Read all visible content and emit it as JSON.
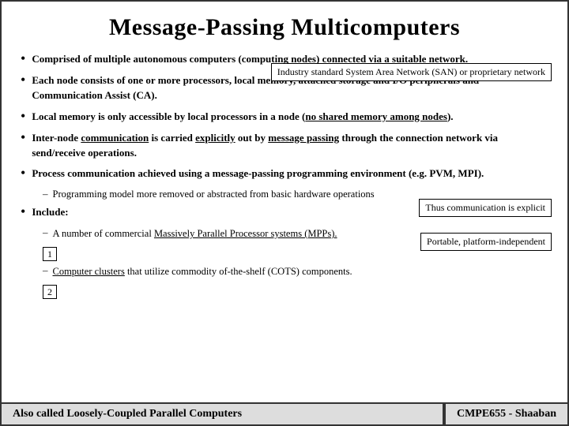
{
  "title": "Message-Passing Multicomputers",
  "bullets": [
    {
      "id": 1,
      "text_parts": [
        {
          "text": "Comprised of multiple autonomous computers (computing nodes) connected via a suitable network.",
          "style": "bold"
        }
      ]
    },
    {
      "id": 2,
      "text_parts": [
        {
          "text": "Each node consists of one or more processors, local memory, attached storage and I/O peripherals and Communication Assist (CA).",
          "style": "bold"
        }
      ]
    },
    {
      "id": 3,
      "text_parts": [
        {
          "text": "Local memory is only accessible by local processors in a node (",
          "style": "bold"
        },
        {
          "text": "no shared memory among nodes",
          "style": "bold-underline"
        },
        {
          "text": ").",
          "style": "bold"
        }
      ]
    },
    {
      "id": 4,
      "text_parts": [
        {
          "text": "Inter-node ",
          "style": "bold"
        },
        {
          "text": "communication",
          "style": "bold-underline"
        },
        {
          "text": " is carried ",
          "style": "bold"
        },
        {
          "text": "explicitly",
          "style": "bold-underline"
        },
        {
          "text": " out by ",
          "style": "bold"
        },
        {
          "text": "message passing",
          "style": "bold-underline"
        },
        {
          "text": " through the connection network via send/receive operations.",
          "style": "bold"
        }
      ]
    },
    {
      "id": 5,
      "text_parts": [
        {
          "text": "Process communication achieved using a ",
          "style": "bold"
        },
        {
          "text": "message-passing programming environment (e.g. PVM, MPI).",
          "style": "bold"
        }
      ],
      "subitem": "Programming model more removed or abstracted from basic hardware operations"
    },
    {
      "id": 6,
      "text_parts": [
        {
          "text": "Include:",
          "style": "bold"
        }
      ],
      "numbered": [
        {
          "num": "1",
          "text": "A number of commercial ",
          "link": "Massively Parallel Processor systems (MPPs)."
        },
        {
          "num": "2",
          "text": "Computer clusters",
          "link_prefix": true,
          "rest": " that utilize commodity of-the-shelf (COTS) components."
        }
      ]
    }
  ],
  "tooltips": {
    "san": "Industry standard System Area Network (SAN) or proprietary network",
    "explicit": "Thus communication is explicit",
    "portable": "Portable, platform-independent"
  },
  "bottom": {
    "left": "Also called Loosely-Coupled Parallel Computers",
    "right": "CMPE655 - Shaaban"
  }
}
